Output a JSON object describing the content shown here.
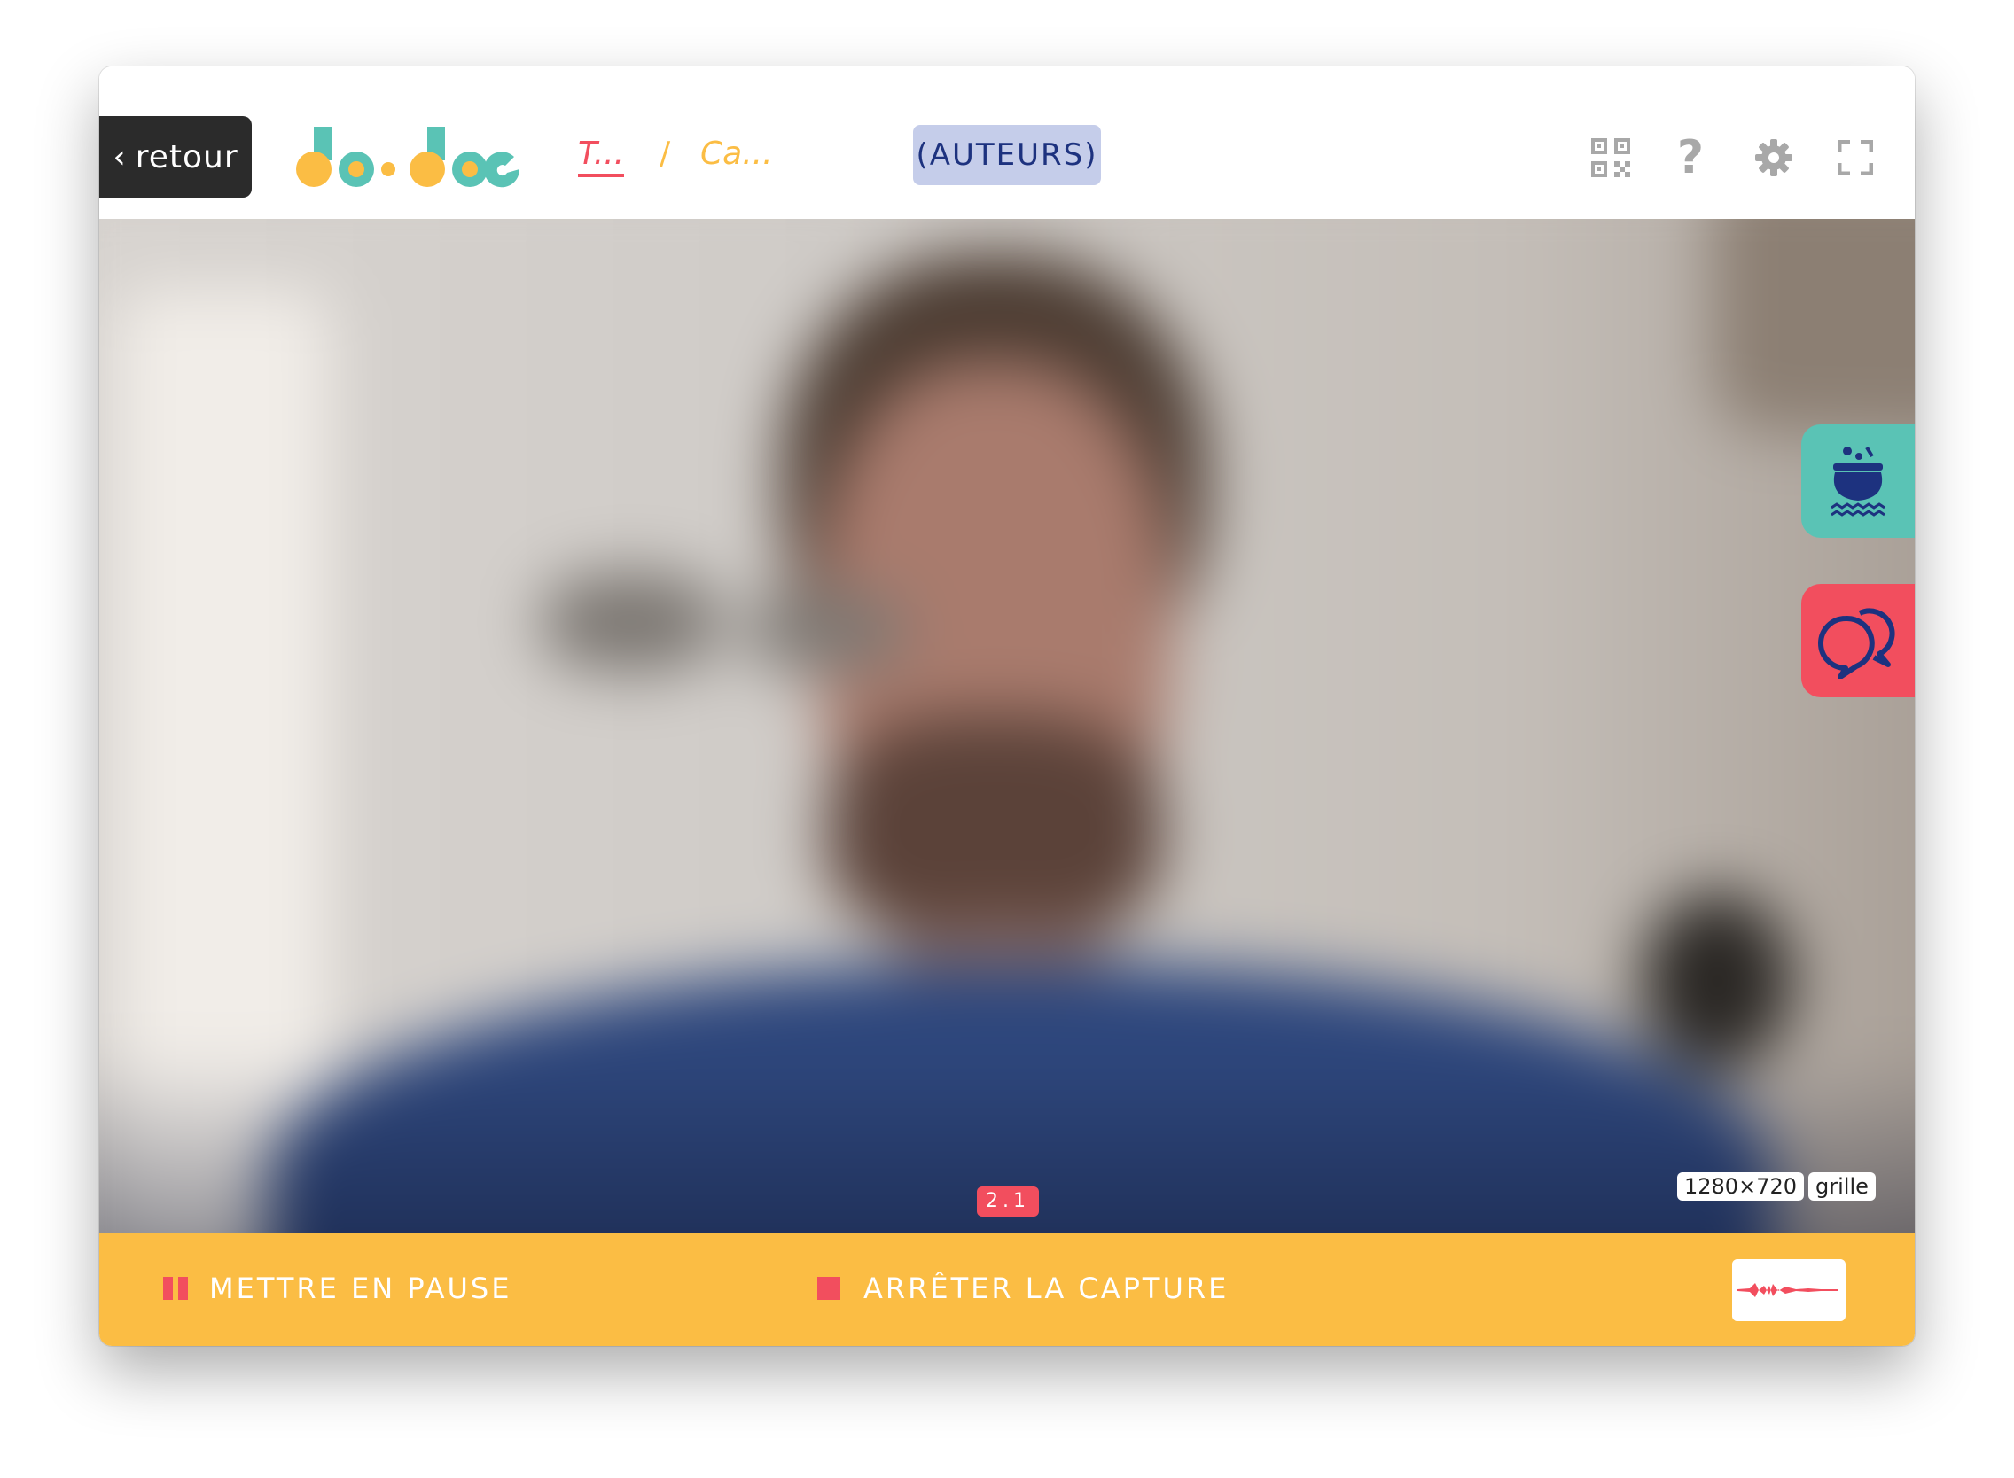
{
  "header": {
    "back_label": "retour",
    "back_chevron": "‹",
    "logo_alt": "dodoc",
    "breadcrumb_1": "T...",
    "breadcrumb_separator": "/",
    "breadcrumb_2": "Ca...",
    "authors_label": "(AUTEURS)",
    "help_glyph": "?"
  },
  "toolbar_icons": [
    "qr-code-icon",
    "help-icon",
    "gear-icon",
    "fullscreen-icon"
  ],
  "side_buttons": [
    "cauldron-icon",
    "chat-bubbles-icon"
  ],
  "video": {
    "resolution": "1280×720",
    "grid_label": "grille",
    "timecode": "2.1"
  },
  "controls": {
    "pause_label": "METTRE EN PAUSE",
    "stop_label": "ARRÊTER LA CAPTURE"
  },
  "colors": {
    "accent_red": "#f24e5e",
    "accent_yellow": "#fbbd44",
    "accent_teal": "#5ac3b5",
    "authors_bg": "#c5cdea",
    "authors_text": "#1d327f"
  }
}
